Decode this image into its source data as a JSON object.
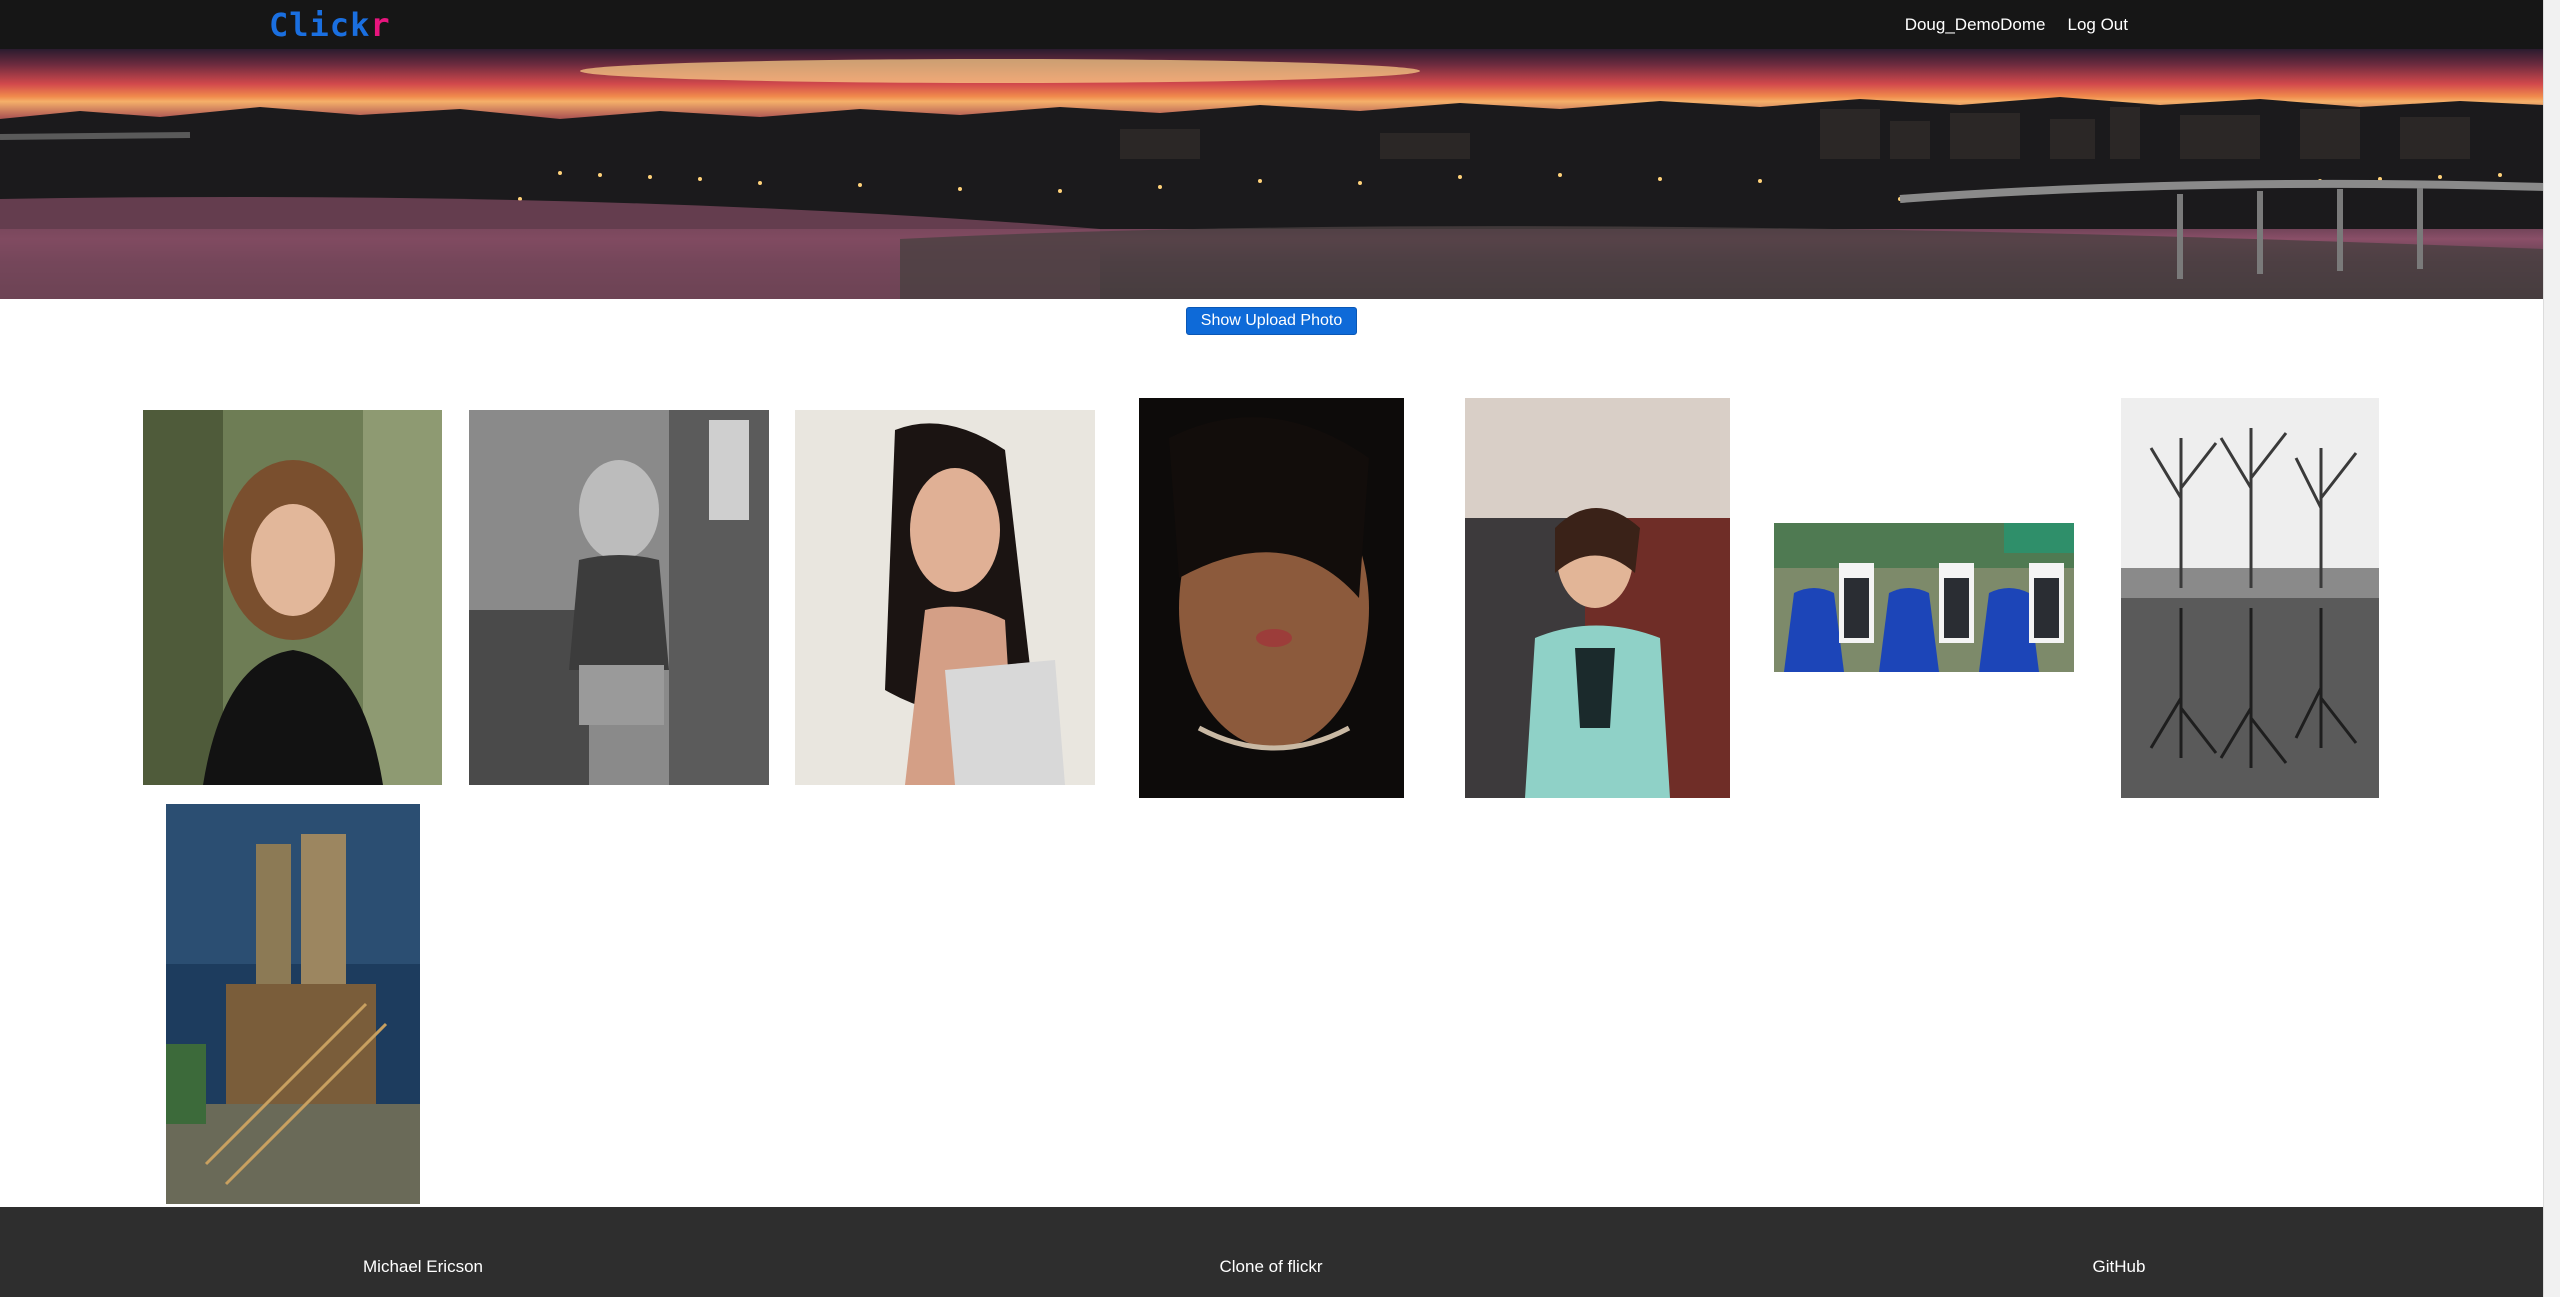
{
  "nav": {
    "logo_main": "Click",
    "logo_accent": "r",
    "username": "Doug_DemoDome",
    "logout": "Log Out"
  },
  "hero": {
    "alt": "City skyline panorama at sunset over river"
  },
  "upload_button": "Show Upload Photo",
  "photos": [
    {
      "name": "photo-woman-curly-hair-lace-top"
    },
    {
      "name": "photo-woman-bw-by-brick-wall"
    },
    {
      "name": "photo-woman-dark-hair-white-top"
    },
    {
      "name": "photo-woman-wet-hair-closeup"
    },
    {
      "name": "photo-woman-teal-dress-brick-wall"
    },
    {
      "name": "photo-wedding-party-couples"
    },
    {
      "name": "photo-bw-trees-reflection"
    },
    {
      "name": "photo-industrial-plant-hdr"
    }
  ],
  "footer": {
    "author": "Michael Ericson",
    "tagline": "Clone of flickr",
    "github": "GitHub"
  },
  "colors": {
    "nav_bg": "#161616",
    "logo_blue": "#1a6fe0",
    "logo_pink": "#e8157e",
    "button_blue": "#0e6ad8",
    "footer_bg": "#2e2e2e"
  }
}
